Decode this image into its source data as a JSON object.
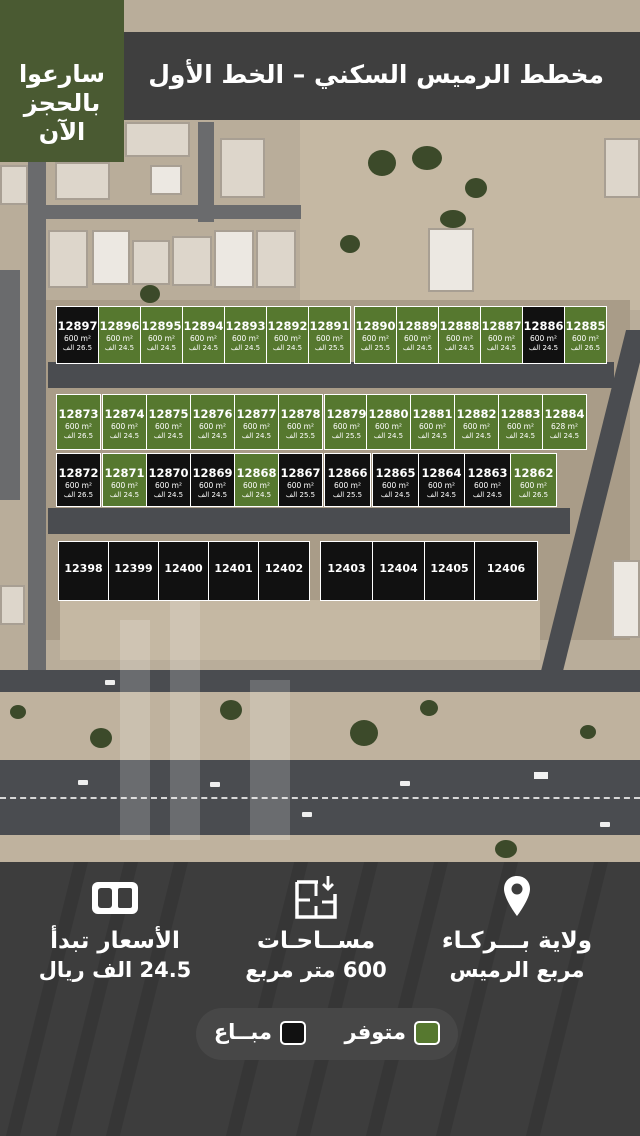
{
  "header": {
    "title": "مخطط الرميس السكني –  الخط الأول",
    "cta_lines": [
      "سارعوا",
      "بالحجز",
      "الآن"
    ]
  },
  "colors": {
    "available": "#56782f",
    "sold": "#111111",
    "header_bg": "#3f3f3f",
    "cta_bg": "#4a5a32",
    "panel_bg": "#3d3d3d"
  },
  "plots": {
    "row1": [
      {
        "id": "12897",
        "area": "600 m²",
        "price": "26.5 الف",
        "status": "sold"
      },
      {
        "id": "12896",
        "area": "600 m²",
        "price": "24.5 الف",
        "status": "available"
      },
      {
        "id": "12895",
        "area": "600 m²",
        "price": "24.5 الف",
        "status": "available"
      },
      {
        "id": "12894",
        "area": "600 m²",
        "price": "24.5 الف",
        "status": "available"
      },
      {
        "id": "12893",
        "area": "600 m²",
        "price": "24.5 الف",
        "status": "available"
      },
      {
        "id": "12892",
        "area": "600 m²",
        "price": "24.5 الف",
        "status": "available"
      },
      {
        "id": "12891",
        "area": "600 m²",
        "price": "25.5 الف",
        "status": "available"
      },
      {
        "id": "12890",
        "area": "600 m²",
        "price": "25.5 الف",
        "status": "available"
      },
      {
        "id": "12889",
        "area": "600 m²",
        "price": "24.5 الف",
        "status": "available"
      },
      {
        "id": "12888",
        "area": "600 m²",
        "price": "24.5 الف",
        "status": "available"
      },
      {
        "id": "12887",
        "area": "600 m²",
        "price": "24.5 الف",
        "status": "available"
      },
      {
        "id": "12886",
        "area": "600 m²",
        "price": "24.5 الف",
        "status": "sold"
      },
      {
        "id": "12885",
        "area": "600 m²",
        "price": "26.5 الف",
        "status": "available"
      }
    ],
    "row2": [
      {
        "id": "12873",
        "area": "600 m²",
        "price": "26.5 الف",
        "status": "available"
      },
      {
        "id": "12874",
        "area": "600 m²",
        "price": "24.5 الف",
        "status": "available"
      },
      {
        "id": "12875",
        "area": "600 m²",
        "price": "24.5 الف",
        "status": "available"
      },
      {
        "id": "12876",
        "area": "600 m²",
        "price": "24.5 الف",
        "status": "available"
      },
      {
        "id": "12877",
        "area": "600 m²",
        "price": "24.5 الف",
        "status": "available"
      },
      {
        "id": "12878",
        "area": "600 m²",
        "price": "25.5 الف",
        "status": "available"
      },
      {
        "id": "12879",
        "area": "600 m²",
        "price": "25.5 الف",
        "status": "available"
      },
      {
        "id": "12880",
        "area": "600 m²",
        "price": "24.5 الف",
        "status": "available"
      },
      {
        "id": "12881",
        "area": "600 m²",
        "price": "24.5 الف",
        "status": "available"
      },
      {
        "id": "12882",
        "area": "600 m²",
        "price": "24.5 الف",
        "status": "available"
      },
      {
        "id": "12883",
        "area": "600 m²",
        "price": "24.5 الف",
        "status": "available"
      },
      {
        "id": "12884",
        "area": "628 m²",
        "price": "24.5 الف",
        "status": "available"
      }
    ],
    "row3": [
      {
        "id": "12872",
        "area": "600 m²",
        "price": "26.5 الف",
        "status": "sold"
      },
      {
        "id": "12871",
        "area": "600 m²",
        "price": "24.5 الف",
        "status": "available"
      },
      {
        "id": "12870",
        "area": "600 m²",
        "price": "24.5 الف",
        "status": "sold"
      },
      {
        "id": "12869",
        "area": "600 m²",
        "price": "24.5 الف",
        "status": "sold"
      },
      {
        "id": "12868",
        "area": "600 m²",
        "price": "24.5 الف",
        "status": "available"
      },
      {
        "id": "12867",
        "area": "600 m²",
        "price": "25.5 الف",
        "status": "sold"
      },
      {
        "id": "12866",
        "area": "600 m²",
        "price": "25.5 الف",
        "status": "sold"
      },
      {
        "id": "12865",
        "area": "600 m²",
        "price": "24.5 الف",
        "status": "sold"
      },
      {
        "id": "12864",
        "area": "600 m²",
        "price": "24.5 الف",
        "status": "sold"
      },
      {
        "id": "12863",
        "area": "600 m²",
        "price": "24.5 الف",
        "status": "sold"
      },
      {
        "id": "12862",
        "area": "600 m²",
        "price": "26.5 الف",
        "status": "available"
      }
    ],
    "row4": [
      {
        "id": "12398",
        "status": "sold"
      },
      {
        "id": "12399",
        "status": "sold"
      },
      {
        "id": "12400",
        "status": "sold"
      },
      {
        "id": "12401",
        "status": "sold"
      },
      {
        "id": "12402",
        "status": "sold"
      },
      {
        "id": "12403",
        "status": "sold"
      },
      {
        "id": "12404",
        "status": "sold"
      },
      {
        "id": "12405",
        "status": "sold"
      },
      {
        "id": "12406",
        "status": "sold"
      }
    ]
  },
  "info": {
    "location": {
      "icon": "location-pin-icon",
      "line1": "ولاية بـــركـاء",
      "line2": "مربع الرميس"
    },
    "areas": {
      "icon": "floor-plan-icon",
      "line1": "مســاحـات",
      "line2": "600 متر مربع"
    },
    "prices": {
      "icon": "wallet-icon",
      "line1": "الأسعار تبدأ",
      "line2": "24.5 الف ريال"
    }
  },
  "legend": {
    "available": "متوفر",
    "sold": "مبــاع"
  }
}
